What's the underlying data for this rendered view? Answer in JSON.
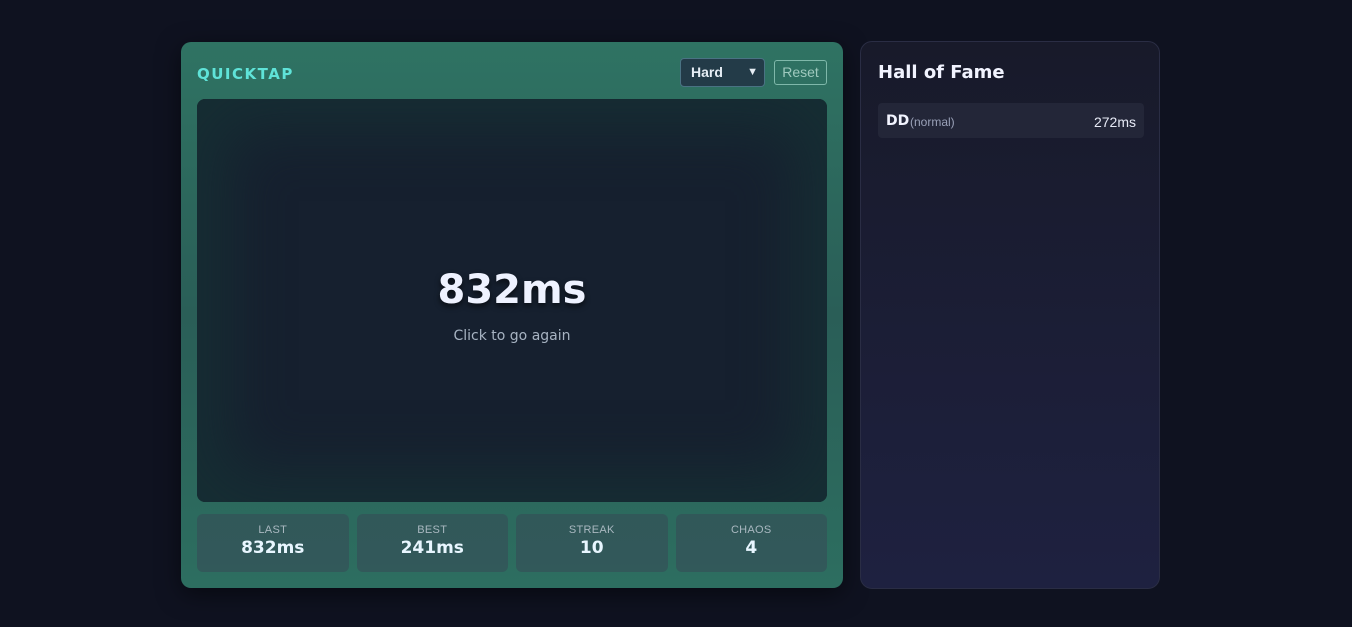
{
  "game": {
    "title": "QUICKTAP",
    "difficulty": {
      "selected": "Hard",
      "chevron_icon": "chevron-down-icon"
    },
    "reset_label": "Reset",
    "arena": {
      "time": "832ms",
      "hint": "Click to go again"
    },
    "stats": [
      {
        "label": "LAST",
        "value": "832ms"
      },
      {
        "label": "BEST",
        "value": "241ms"
      },
      {
        "label": "STREAK",
        "value": "10"
      },
      {
        "label": "CHAOS",
        "value": "4"
      }
    ]
  },
  "hall_of_fame": {
    "title": "Hall of Fame",
    "entries": [
      {
        "name": "DD",
        "mode": "(normal)",
        "time": "272ms"
      }
    ]
  },
  "colors": {
    "accent": "#5fe3d8",
    "background": "#0f1220",
    "panel_green": "#2f7363",
    "arena": "#16202f"
  }
}
